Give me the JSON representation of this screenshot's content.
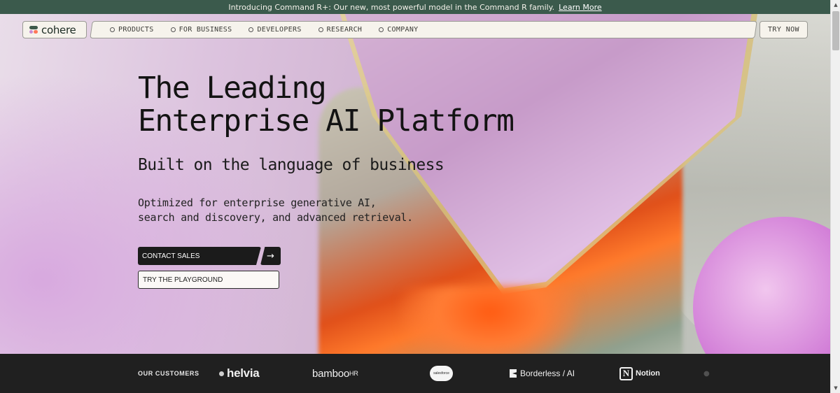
{
  "announcement": {
    "text": "Introducing Command R+: Our new, most powerful model in the Command R family.",
    "link_label": "Learn More"
  },
  "nav": {
    "logo_text": "cohere",
    "items": [
      {
        "label": "PRODUCTS"
      },
      {
        "label": "FOR BUSINESS"
      },
      {
        "label": "DEVELOPERS"
      },
      {
        "label": "RESEARCH"
      },
      {
        "label": "COMPANY"
      }
    ],
    "try_now": "TRY NOW"
  },
  "hero": {
    "title_line1": "The Leading",
    "title_line2": "Enterprise AI Platform",
    "subtitle": "Built on the language of business",
    "description_line1": "Optimized for enterprise generative AI,",
    "description_line2": "search and discovery, and advanced retrieval.",
    "primary_cta": "CONTACT SALES",
    "secondary_cta": "TRY THE PLAYGROUND"
  },
  "customers": {
    "label": "OUR CUSTOMERS",
    "logos": {
      "helvia": "helvia",
      "bamboo": "bamboo",
      "bamboo_suffix": "HR",
      "salesforce": "salesforce",
      "borderless": "Borderless / AI",
      "notion": "Notion",
      "notion_letter": "N"
    }
  },
  "colors": {
    "announcement_bg": "#3b5a4c",
    "customers_bg": "#202020",
    "cta_dark": "#1b1b1b"
  }
}
